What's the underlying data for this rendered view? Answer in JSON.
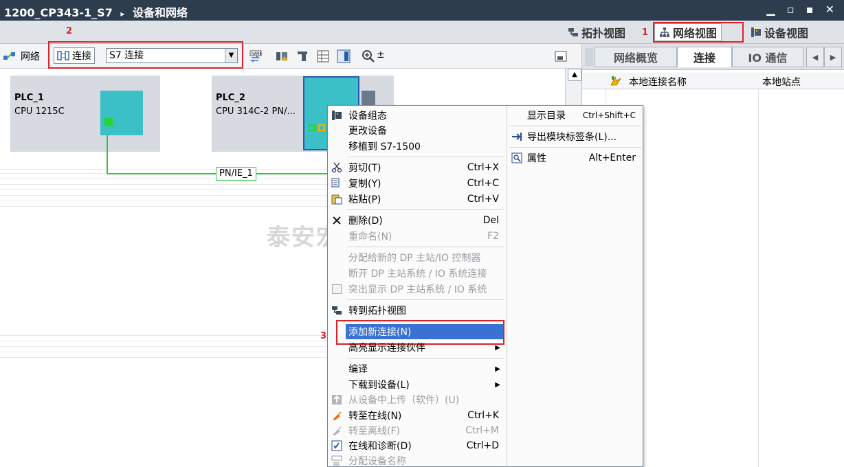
{
  "window": {
    "project": "1200_CP343-1_S7",
    "breadcrumb_sep": "▸",
    "section": "设备和网络",
    "controls": "▁ ▫ ▪ ✕"
  },
  "view_tabs": {
    "topology": "拓扑视图",
    "network": "网络视图",
    "device": "设备视图"
  },
  "annotations": {
    "n1": "1",
    "n2": "2",
    "n3": "3"
  },
  "toolbar": {
    "network_label": "网络",
    "connection_label": "连接",
    "connection_type": "S7 连接",
    "zoom_label": "±"
  },
  "canvas": {
    "plc1": {
      "name": "PLC_1",
      "type": "CPU 1215C"
    },
    "plc2": {
      "name": "PLC_2",
      "type": "CPU 314C-2 PN/..."
    },
    "subnet": "PN/IE_1"
  },
  "right_panel": {
    "tabs": [
      "网络概览",
      "连接",
      "IO 通信"
    ],
    "columns": [
      "本地连接名称",
      "本地站点"
    ]
  },
  "context_menu": {
    "left": [
      {
        "label": "设备组态",
        "shortcut": "",
        "enabled": true
      },
      {
        "label": "更改设备",
        "shortcut": "",
        "enabled": true
      },
      {
        "label": "移植到 S7-1500",
        "shortcut": "",
        "enabled": true
      },
      {
        "label": "剪切(T)",
        "shortcut": "Ctrl+X",
        "enabled": true
      },
      {
        "label": "复制(Y)",
        "shortcut": "Ctrl+C",
        "enabled": true
      },
      {
        "label": "粘贴(P)",
        "shortcut": "Ctrl+V",
        "enabled": true
      },
      {
        "label": "删除(D)",
        "shortcut": "Del",
        "enabled": true
      },
      {
        "label": "重命名(N)",
        "shortcut": "F2",
        "enabled": false
      },
      {
        "label": "分配给新的 DP 主站/IO 控制器",
        "shortcut": "",
        "enabled": false
      },
      {
        "label": "断开 DP 主站系统 / IO 系统连接",
        "shortcut": "",
        "enabled": false
      },
      {
        "label": "突出显示 DP 主站系统 / IO 系统",
        "shortcut": "",
        "enabled": false
      },
      {
        "label": "转到拓扑视图",
        "shortcut": "",
        "enabled": true
      },
      {
        "label": "添加新连接(N)",
        "shortcut": "",
        "enabled": true
      },
      {
        "label": "高亮显示连接伙伴",
        "shortcut": "",
        "enabled": true
      },
      {
        "label": "编译",
        "shortcut": "",
        "enabled": true
      },
      {
        "label": "下载到设备(L)",
        "shortcut": "",
        "enabled": true
      },
      {
        "label": "从设备中上传（软件）(U)",
        "shortcut": "",
        "enabled": false
      },
      {
        "label": "转至在线(N)",
        "shortcut": "Ctrl+K",
        "enabled": true
      },
      {
        "label": "转至离线(F)",
        "shortcut": "Ctrl+M",
        "enabled": false
      },
      {
        "label": "在线和诊断(D)",
        "shortcut": "Ctrl+D",
        "enabled": true
      },
      {
        "label": "分配设备名称",
        "shortcut": "",
        "enabled": false
      }
    ],
    "right": [
      {
        "label": "显示目录",
        "shortcut": "Ctrl+Shift+C"
      },
      {
        "label": "导出模块标签条(L)...",
        "shortcut": ""
      },
      {
        "label": "属性",
        "shortcut": "Alt+Enter"
      }
    ]
  },
  "watermark": "泰安宏德自动化科技有限公司",
  "colors": {
    "titlebar": "#2d3d4e",
    "accent_red": "#d9222a",
    "highlight": "#3a72d4",
    "subnet_green": "#3bbf4a",
    "module_teal": "#3cc0c8"
  }
}
